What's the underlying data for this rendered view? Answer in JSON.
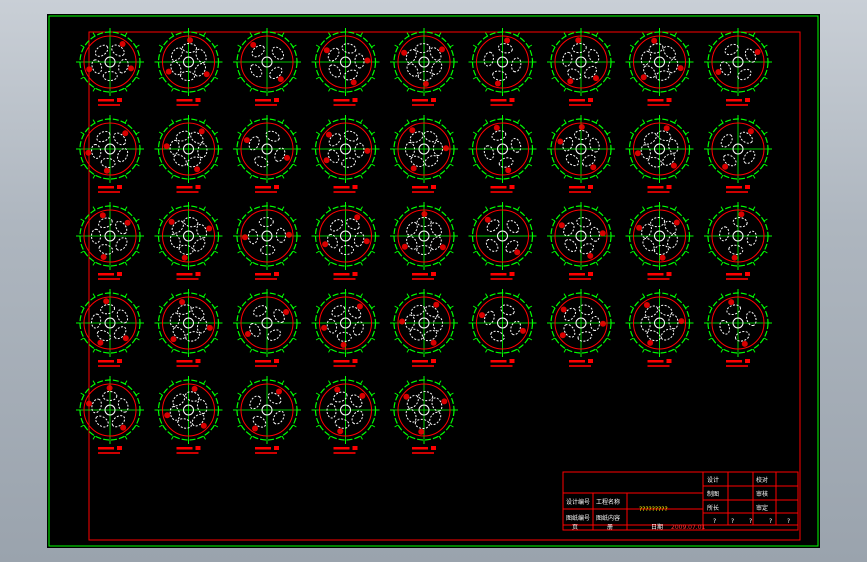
{
  "title_block": {
    "design_no_label": "设计编号",
    "drawing_no_label": "图纸编号",
    "project_name_label": "工程名称",
    "drawing_content_label": "图纸内容",
    "project_name_value": "",
    "drawing_content_value": "?????????",
    "sheet_label": "页",
    "sheet_count_label": "册",
    "date_label": "日期",
    "date_value": "2009.07.01",
    "designer_label": "设计",
    "drafter_label": "制图",
    "office_head_label": "所长",
    "checker_label": "校对",
    "reviewer_label": "审核",
    "approver_label": "审定",
    "bottom_marks": [
      "?",
      "?",
      "?",
      "?",
      "?"
    ]
  },
  "colors": {
    "sheet_background": "#000000",
    "frame_green": "#00ff00",
    "border_red": "#ff0000",
    "part_white": "#ffffff",
    "label_red": "#ff0000",
    "label_green": "#00ff00"
  },
  "parts": {
    "count": 41,
    "per_row": [
      9,
      9,
      9,
      9,
      5
    ],
    "icon": "flange-cutting-plan"
  }
}
